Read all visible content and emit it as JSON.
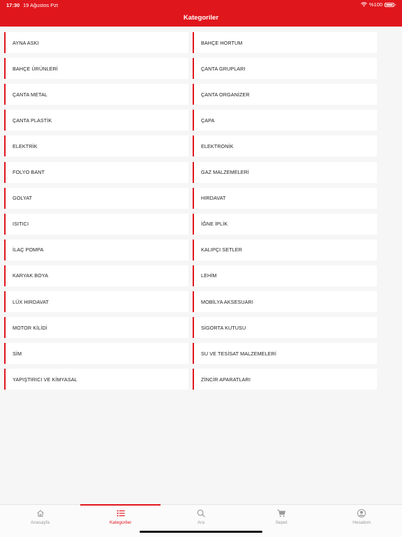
{
  "status_bar": {
    "time": "17:30",
    "date": "19 Ağustos Pzt",
    "battery": "%100"
  },
  "header": {
    "title": "Kategoriler"
  },
  "categories": [
    "AYNA ASKI",
    "BAHÇE HORTUM",
    "BAHÇE ÜRÜNLERİ",
    "ÇANTA GRUPLARI",
    "ÇANTA METAL",
    "ÇANTA ORGANİZER",
    "ÇANTA PLASTİK",
    "ÇAPA",
    "ELEKTRİK",
    "ELEKTRONİK",
    "FOLYO BANT",
    "GAZ MALZEMELERİ",
    "GOLYAT",
    "HIRDAVAT",
    "ISITICI",
    "İĞNE İPLİK",
    "İLAÇ POMPA",
    "KALIPÇI SETLER",
    "KARYAK BOYA",
    "LEHİM",
    "LÜX HIRDAVAT",
    "MOBİLYA AKSESUARI",
    "MOTOR KİLİDİ",
    "SİGORTA KUTUSU",
    "SİM",
    "SU VE TESİSAT MALZEMELERİ",
    "YAPIŞTIRICI VE KİMYASAL",
    "ZİNCİR APARATLARI"
  ],
  "tabs": [
    {
      "label": "Anasayfa",
      "icon": "home-icon"
    },
    {
      "label": "Kategoriler",
      "icon": "list-icon"
    },
    {
      "label": "Ara",
      "icon": "search-icon"
    },
    {
      "label": "Sepet",
      "icon": "cart-icon"
    },
    {
      "label": "Hesabım",
      "icon": "account-icon"
    }
  ],
  "active_tab": "Kategoriler",
  "colors": {
    "accent": "#e0161d",
    "background": "#f6f6f7",
    "card": "#ffffff",
    "tab_inactive": "#9a9a9a"
  }
}
